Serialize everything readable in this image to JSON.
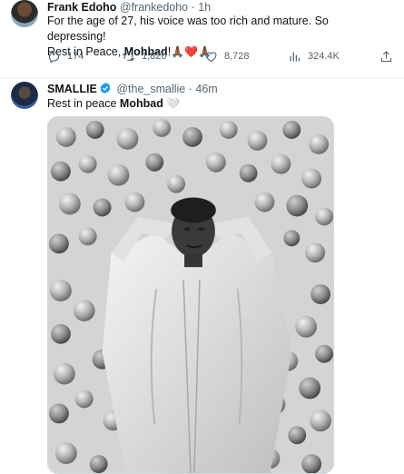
{
  "tweet1": {
    "author_name": "Frank Edoho",
    "author_handle": "@frankedoho",
    "separator": "·",
    "time": "1h",
    "text_line1": "For the age of 27, his voice was too rich and mature. So depressing!",
    "text_line2_prefix": "Rest in Peace, ",
    "text_line2_bold": "Mohbad",
    "text_line2_suffix": "!",
    "emojis": [
      "🙏🏾",
      "❤️",
      "🙏🏾"
    ],
    "stats": {
      "replies": "174",
      "retweets": "1,820",
      "likes": "8,728",
      "views": "324.4K"
    }
  },
  "tweet2": {
    "author_name": "SMALLIE",
    "author_handle": "@the_smallie",
    "separator": "·",
    "time": "46m",
    "verified": true,
    "text_prefix": "Rest in peace ",
    "text_bold": "Mohbad",
    "text_emoji": "🤍",
    "photo_alt": "Black and white photo of a man lying among apples and pears",
    "icons": [
      "verified-badge-icon"
    ]
  },
  "icons": [
    "reply-icon",
    "retweet-icon",
    "like-icon",
    "views-icon",
    "share-icon"
  ],
  "colors": {
    "verified": "#1d9bf0",
    "muted_text": "#536471",
    "primary_text": "#0f1419",
    "divider": "#eff3f4"
  }
}
